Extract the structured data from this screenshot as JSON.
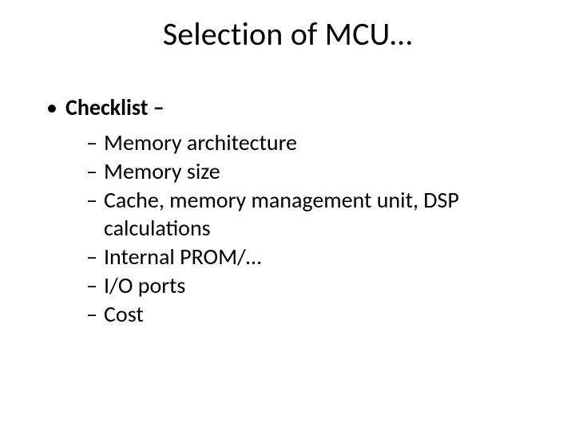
{
  "title": "Selection of MCU…",
  "heading": "Checklist –",
  "items": [
    "Memory architecture",
    "Memory size",
    "Cache, memory management unit, DSP calculations",
    "Internal PROM/…",
    "I/O ports",
    "Cost"
  ]
}
